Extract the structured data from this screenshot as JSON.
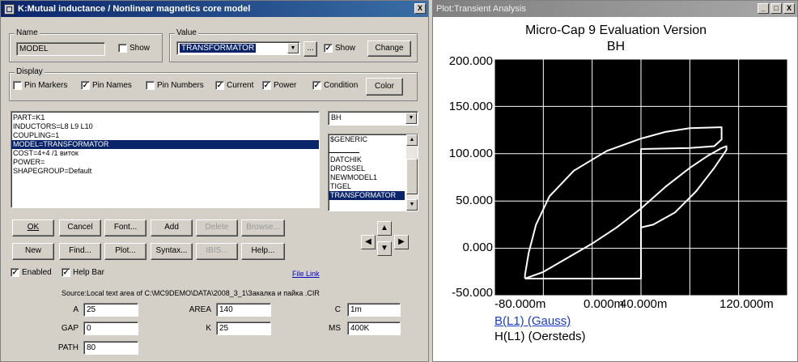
{
  "dialog": {
    "title": "K:Mutual inductance / Nonlinear magnetics core model",
    "close_glyph": "X",
    "name_group": {
      "label": "Name",
      "value": "MODEL",
      "show_label": "Show",
      "show_checked": false
    },
    "value_group": {
      "label": "Value",
      "value": "TRANSFORMATOR",
      "browse_label": "...",
      "show_label": "Show",
      "show_checked": true,
      "change_label": "Change"
    },
    "display_group": {
      "label": "Display",
      "options": [
        {
          "label": "Pin Markers",
          "checked": false
        },
        {
          "label": "Pin Names",
          "checked": true
        },
        {
          "label": "Pin Numbers",
          "checked": false
        },
        {
          "label": "Current",
          "checked": true
        },
        {
          "label": "Power",
          "checked": true
        },
        {
          "label": "Condition",
          "checked": true
        }
      ],
      "color_label": "Color"
    },
    "attributes": [
      "PART=K1",
      "INDUCTORS=L8 L9 L10",
      "COUPLING=1",
      "MODEL=TRANSFORMATOR",
      "COST=4+4 /1 виток",
      "POWER=",
      "SHAPEGROUP=Default"
    ],
    "attributes_selected": 3,
    "model_type": "BH",
    "models": [
      "$GENERIC",
      "",
      "DATCHIK",
      "DROSSEL",
      "NEWMODEL1",
      "TIGEL",
      "TRANSFORMATOR"
    ],
    "models_selected": 6,
    "buttons_row1": [
      {
        "label": "OK",
        "enabled": true
      },
      {
        "label": "Cancel",
        "enabled": true
      },
      {
        "label": "Font...",
        "enabled": true
      },
      {
        "label": "Add",
        "enabled": true
      },
      {
        "label": "Delete",
        "enabled": false
      },
      {
        "label": "Browse...",
        "enabled": false
      }
    ],
    "buttons_row2": [
      {
        "label": "New",
        "enabled": true
      },
      {
        "label": "Find...",
        "enabled": true
      },
      {
        "label": "Plot...",
        "enabled": true
      },
      {
        "label": "Syntax...",
        "enabled": true
      },
      {
        "label": "IBIS...",
        "enabled": false
      },
      {
        "label": "Help...",
        "enabled": true
      }
    ],
    "enabled_label": "Enabled",
    "helpbar_label": "Help Bar",
    "file_link_label": "File Link",
    "source_text": "Source:Local text area of C:\\MC9DEMO\\DATA\\2008_3_1\\Закалка и пайка  .CIR",
    "params": [
      {
        "label": "A",
        "value": "25"
      },
      {
        "label": "GAP",
        "value": "0"
      },
      {
        "label": "PATH",
        "value": "80"
      },
      {
        "label": "AREA",
        "value": "140"
      },
      {
        "label": "K",
        "value": "25"
      },
      {
        "label": "C",
        "value": "1m"
      },
      {
        "label": "MS",
        "value": "400K"
      }
    ]
  },
  "plot_window": {
    "title": "Plot:Transient Analysis",
    "buttons": [
      "_",
      "□",
      "X"
    ]
  },
  "chart_data": {
    "type": "line",
    "title": "Micro-Cap 9 Evaluation Version",
    "subtitle": "BH",
    "xlabel": "H(L1) (Oersteds)",
    "ylabel": "B(L1) (Gauss)",
    "xlim": [
      -120,
      120
    ],
    "ylim": [
      -50,
      200
    ],
    "x_ticks": [
      -120,
      -80,
      -40,
      0,
      40,
      80,
      120
    ],
    "y_ticks": [
      -50,
      0,
      50,
      100,
      150,
      200
    ],
    "x_tick_labels": [
      "-80.000m",
      "0.000m",
      "40.000m",
      "120.000m"
    ],
    "y_tick_labels": [
      "200.000",
      "150.000",
      "100.000",
      "50.000",
      "0.000",
      "-50.000"
    ],
    "grid": true,
    "series": [
      {
        "values": [
          [
            -95,
            -32
          ],
          [
            -95,
            -28
          ],
          [
            -92,
            -5
          ],
          [
            -86,
            25
          ],
          [
            -75,
            55
          ],
          [
            -55,
            82
          ],
          [
            -28,
            103
          ],
          [
            0,
            116
          ],
          [
            20,
            123
          ],
          [
            40,
            127
          ],
          [
            66,
            128
          ],
          [
            66,
            115
          ],
          [
            60,
            108
          ],
          [
            40,
            106
          ],
          [
            0,
            105
          ],
          [
            0,
            -32
          ],
          [
            -95,
            -32
          ]
        ]
      },
      {
        "values": [
          [
            -95,
            -32
          ],
          [
            -80,
            -25
          ],
          [
            -60,
            -10
          ],
          [
            -40,
            5
          ],
          [
            -20,
            22
          ],
          [
            0,
            42
          ],
          [
            20,
            65
          ],
          [
            40,
            85
          ],
          [
            55,
            98
          ],
          [
            66,
            106
          ],
          [
            70,
            108
          ],
          [
            70,
            104
          ],
          [
            60,
            85
          ],
          [
            45,
            60
          ],
          [
            28,
            38
          ],
          [
            10,
            25
          ],
          [
            0,
            22
          ]
        ]
      }
    ]
  }
}
